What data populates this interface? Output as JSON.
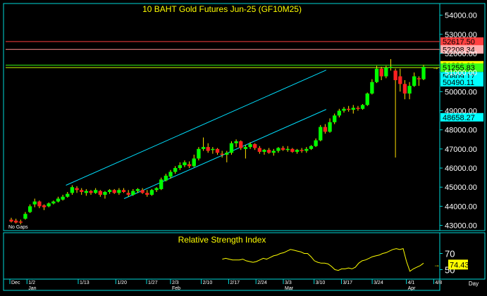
{
  "chart_data": [
    {
      "type": "candlestick",
      "title": "10 BAHT  Gold Futures Jun-25  (GF10M25)",
      "ylim": [
        42800,
        54500
      ],
      "y_ticks": [
        "54000.00",
        "53000.00",
        "52000.00",
        "51000.00",
        "50000.00",
        "49000.00",
        "48000.00",
        "47000.00",
        "46000.00",
        "45000.00",
        "44000.00",
        "43000.00"
      ],
      "annotation": "No Gaps",
      "horizontal_lines": [
        {
          "price": 52617.5,
          "label": "52617.50",
          "color": "#ff4040",
          "label_bg": "#ff4040",
          "label_fg": "#000000"
        },
        {
          "price": 52208.34,
          "label": "52208.34",
          "color": "#ff9090",
          "label_bg": "#ffb0b0",
          "label_fg": "#000000"
        },
        {
          "price": 51380.0,
          "label": "51380.00",
          "color": "#39ff14",
          "label_bg": "#ffff00",
          "label_fg": "#000000"
        },
        {
          "price": 51255.83,
          "label": "51255.83",
          "color": "#c8ff00",
          "label_bg": "#39ff14",
          "label_fg": "#000000"
        }
      ],
      "channel_labels": [
        {
          "price": 50809.17,
          "label": "50809.17",
          "label_bg": "#00ffff",
          "label_fg": "#000000"
        },
        {
          "price": 50490.11,
          "label": "50490.11",
          "label_bg": "#00ffff",
          "label_fg": "#000000"
        },
        {
          "price": 48658.27,
          "label": "48658.27",
          "label_bg": "#00ffff",
          "label_fg": "#000000"
        }
      ],
      "channel_lines": [
        {
          "from": {
            "bar": 16,
            "price": 45100
          },
          "to": {
            "bar": 88,
            "price": 50760
          }
        },
        {
          "from": {
            "bar": 33,
            "price": 44400
          },
          "to": {
            "bar": 88,
            "price": 48700
          }
        }
      ],
      "candles": [
        {
          "o": 43300,
          "h": 43400,
          "l": 43150,
          "c": 43200
        },
        {
          "o": 43250,
          "h": 43350,
          "l": 43100,
          "c": 43150
        },
        {
          "o": 43200,
          "h": 43300,
          "l": 43050,
          "c": 43180
        },
        {
          "o": 43350,
          "h": 43700,
          "l": 43300,
          "c": 43600
        },
        {
          "o": 43700,
          "h": 44100,
          "l": 43650,
          "c": 44000
        },
        {
          "o": 44100,
          "h": 44400,
          "l": 43950,
          "c": 44250
        },
        {
          "o": 44250,
          "h": 44300,
          "l": 43900,
          "c": 44000
        },
        {
          "o": 44050,
          "h": 44100,
          "l": 43800,
          "c": 43950
        },
        {
          "o": 44000,
          "h": 44200,
          "l": 43950,
          "c": 44150
        },
        {
          "o": 44150,
          "h": 44300,
          "l": 44100,
          "c": 44250
        },
        {
          "o": 44250,
          "h": 44500,
          "l": 44200,
          "c": 44400
        },
        {
          "o": 44350,
          "h": 44600,
          "l": 44300,
          "c": 44500
        },
        {
          "o": 44500,
          "h": 44750,
          "l": 44450,
          "c": 44650
        },
        {
          "o": 44700,
          "h": 45100,
          "l": 44600,
          "c": 45000
        },
        {
          "o": 44950,
          "h": 45050,
          "l": 44700,
          "c": 44850
        },
        {
          "o": 44850,
          "h": 44950,
          "l": 44600,
          "c": 44750
        },
        {
          "o": 44700,
          "h": 44900,
          "l": 44550,
          "c": 44800
        },
        {
          "o": 44800,
          "h": 44850,
          "l": 44600,
          "c": 44700
        },
        {
          "o": 44700,
          "h": 44950,
          "l": 44650,
          "c": 44850
        },
        {
          "o": 44800,
          "h": 44850,
          "l": 44500,
          "c": 44600
        },
        {
          "o": 44600,
          "h": 44800,
          "l": 44400,
          "c": 44750
        },
        {
          "o": 44750,
          "h": 44900,
          "l": 44650,
          "c": 44850
        },
        {
          "o": 44850,
          "h": 44900,
          "l": 44650,
          "c": 44700
        },
        {
          "o": 44700,
          "h": 44950,
          "l": 44600,
          "c": 44850
        },
        {
          "o": 44850,
          "h": 44950,
          "l": 44700,
          "c": 44750
        },
        {
          "o": 44700,
          "h": 44850,
          "l": 44500,
          "c": 44600
        },
        {
          "o": 44600,
          "h": 44900,
          "l": 44550,
          "c": 44800
        },
        {
          "o": 44800,
          "h": 44950,
          "l": 44700,
          "c": 44900
        },
        {
          "o": 44850,
          "h": 44950,
          "l": 44650,
          "c": 44700
        },
        {
          "o": 44700,
          "h": 44850,
          "l": 44500,
          "c": 44600
        },
        {
          "o": 44600,
          "h": 44900,
          "l": 44550,
          "c": 44850
        },
        {
          "o": 44850,
          "h": 45000,
          "l": 44750,
          "c": 44950
        },
        {
          "o": 44900,
          "h": 45500,
          "l": 44850,
          "c": 45400
        },
        {
          "o": 45350,
          "h": 45700,
          "l": 45300,
          "c": 45600
        },
        {
          "o": 45550,
          "h": 45900,
          "l": 45450,
          "c": 45800
        },
        {
          "o": 45800,
          "h": 46100,
          "l": 45700,
          "c": 46000
        },
        {
          "o": 46000,
          "h": 46300,
          "l": 45900,
          "c": 46150
        },
        {
          "o": 46150,
          "h": 46400,
          "l": 46050,
          "c": 46300
        },
        {
          "o": 46200,
          "h": 46350,
          "l": 46000,
          "c": 46100
        },
        {
          "o": 46100,
          "h": 46700,
          "l": 46050,
          "c": 46500
        },
        {
          "o": 46500,
          "h": 47100,
          "l": 46400,
          "c": 47000
        },
        {
          "o": 47000,
          "h": 47600,
          "l": 46900,
          "c": 47100
        },
        {
          "o": 47100,
          "h": 47300,
          "l": 46800,
          "c": 46900
        },
        {
          "o": 46950,
          "h": 47100,
          "l": 46750,
          "c": 47000
        },
        {
          "o": 47000,
          "h": 47050,
          "l": 46700,
          "c": 46800
        },
        {
          "o": 46750,
          "h": 46900,
          "l": 46550,
          "c": 46700
        },
        {
          "o": 46700,
          "h": 46900,
          "l": 46300,
          "c": 46800
        },
        {
          "o": 46800,
          "h": 47400,
          "l": 46700,
          "c": 47300
        },
        {
          "o": 47300,
          "h": 47500,
          "l": 47100,
          "c": 47400
        },
        {
          "o": 47400,
          "h": 47450,
          "l": 46950,
          "c": 47050
        },
        {
          "o": 47000,
          "h": 47200,
          "l": 46500,
          "c": 47100
        },
        {
          "o": 47100,
          "h": 47350,
          "l": 47000,
          "c": 47250
        },
        {
          "o": 47250,
          "h": 47300,
          "l": 46950,
          "c": 47050
        },
        {
          "o": 47050,
          "h": 47150,
          "l": 46750,
          "c": 46850
        },
        {
          "o": 46850,
          "h": 47000,
          "l": 46700,
          "c": 46950
        },
        {
          "o": 46950,
          "h": 47050,
          "l": 46750,
          "c": 46800
        },
        {
          "o": 46800,
          "h": 47000,
          "l": 46650,
          "c": 46900
        },
        {
          "o": 46900,
          "h": 47100,
          "l": 46800,
          "c": 47050
        },
        {
          "o": 47050,
          "h": 47150,
          "l": 46900,
          "c": 46950
        },
        {
          "o": 46950,
          "h": 47150,
          "l": 46850,
          "c": 47000
        },
        {
          "o": 47000,
          "h": 47050,
          "l": 46800,
          "c": 46850
        },
        {
          "o": 46850,
          "h": 47000,
          "l": 46750,
          "c": 46950
        },
        {
          "o": 46950,
          "h": 47050,
          "l": 46800,
          "c": 46900
        },
        {
          "o": 46900,
          "h": 47100,
          "l": 46800,
          "c": 47000
        },
        {
          "o": 47000,
          "h": 47200,
          "l": 46950,
          "c": 47150
        },
        {
          "o": 47150,
          "h": 47550,
          "l": 47100,
          "c": 47450
        },
        {
          "o": 47450,
          "h": 48250,
          "l": 47400,
          "c": 48150
        },
        {
          "o": 48150,
          "h": 48300,
          "l": 47800,
          "c": 47900
        },
        {
          "o": 47900,
          "h": 48600,
          "l": 47850,
          "c": 48400
        },
        {
          "o": 48400,
          "h": 48850,
          "l": 48300,
          "c": 48750
        },
        {
          "o": 48750,
          "h": 49100,
          "l": 48650,
          "c": 49000
        },
        {
          "o": 49000,
          "h": 49200,
          "l": 48900,
          "c": 49100
        },
        {
          "o": 49100,
          "h": 49250,
          "l": 48950,
          "c": 49050
        },
        {
          "o": 49050,
          "h": 49300,
          "l": 48850,
          "c": 49150
        },
        {
          "o": 49150,
          "h": 49250,
          "l": 49000,
          "c": 49100
        },
        {
          "o": 49100,
          "h": 49350,
          "l": 49050,
          "c": 49300
        },
        {
          "o": 49300,
          "h": 49950,
          "l": 49250,
          "c": 49900
        },
        {
          "o": 49900,
          "h": 50650,
          "l": 49850,
          "c": 50500
        },
        {
          "o": 50500,
          "h": 51350,
          "l": 50450,
          "c": 51200
        },
        {
          "o": 51200,
          "h": 51300,
          "l": 50600,
          "c": 50800
        },
        {
          "o": 50800,
          "h": 51350,
          "l": 50700,
          "c": 51250
        },
        {
          "o": 51250,
          "h": 51700,
          "l": 51100,
          "c": 51300
        },
        {
          "o": 51100,
          "h": 51200,
          "l": 46550,
          "c": 50600
        },
        {
          "o": 50800,
          "h": 51200,
          "l": 50000,
          "c": 50400
        },
        {
          "o": 50400,
          "h": 50600,
          "l": 49600,
          "c": 49900
        },
        {
          "o": 49900,
          "h": 50500,
          "l": 49600,
          "c": 50300
        },
        {
          "o": 50300,
          "h": 51000,
          "l": 50250,
          "c": 50800
        },
        {
          "o": 50700,
          "h": 50800,
          "l": 50300,
          "c": 50650
        },
        {
          "o": 50650,
          "h": 51400,
          "l": 50600,
          "c": 51300
        }
      ],
      "colors": {
        "up": "#00ff00",
        "down": "#ff2020",
        "wick": "#ffe000",
        "frame": "#00d8d8",
        "grid": "#006060",
        "text": "#ffff00"
      }
    },
    {
      "type": "line",
      "title": "Relative Strength Index",
      "series": [
        {
          "values": [
            63,
            64,
            63,
            62,
            62,
            62,
            63,
            61,
            60,
            59,
            60,
            62,
            64,
            63,
            65,
            67,
            68,
            70,
            71,
            73,
            75,
            74,
            73,
            72,
            70,
            70,
            66,
            61,
            59,
            58,
            58,
            57,
            54,
            50,
            49,
            51,
            51,
            52,
            51,
            53,
            58,
            61,
            62,
            64,
            66,
            67,
            68,
            70,
            71,
            73,
            75,
            76,
            75,
            76,
            60,
            48,
            51,
            53,
            55,
            58
          ]
        }
      ],
      "last_value_label": "74.43",
      "y_ticks": [
        "70",
        "50"
      ],
      "ylim": [
        40,
        80
      ],
      "start_bar": 30
    }
  ],
  "x_axis": {
    "day_labels": [
      {
        "bar": 0,
        "text": "Dec"
      },
      {
        "bar": 5,
        "text": "1/2"
      },
      {
        "bar": 20,
        "text": "1/13"
      },
      {
        "bar": 31,
        "text": "1/20"
      },
      {
        "bar": 40,
        "text": "1/27"
      },
      {
        "bar": 47,
        "text": "2/3"
      },
      {
        "bar": 56,
        "text": "2/10"
      },
      {
        "bar": 64,
        "text": "2/17"
      },
      {
        "bar": 72,
        "text": "2/24"
      },
      {
        "bar": 80,
        "text": "3/3"
      },
      {
        "bar": 89,
        "text": "3/10"
      },
      {
        "bar": 97,
        "text": "3/17"
      },
      {
        "bar": 106,
        "text": "3/24"
      },
      {
        "bar": 116,
        "text": "4/1"
      },
      {
        "bar": 124,
        "text": "4/8"
      }
    ],
    "month_labels": [
      {
        "bar": 5,
        "text": "Jan"
      },
      {
        "bar": 47,
        "text": "Feb"
      },
      {
        "bar": 80,
        "text": "Mar"
      },
      {
        "bar": 116,
        "text": "Apr"
      }
    ],
    "period_label": "Day"
  }
}
